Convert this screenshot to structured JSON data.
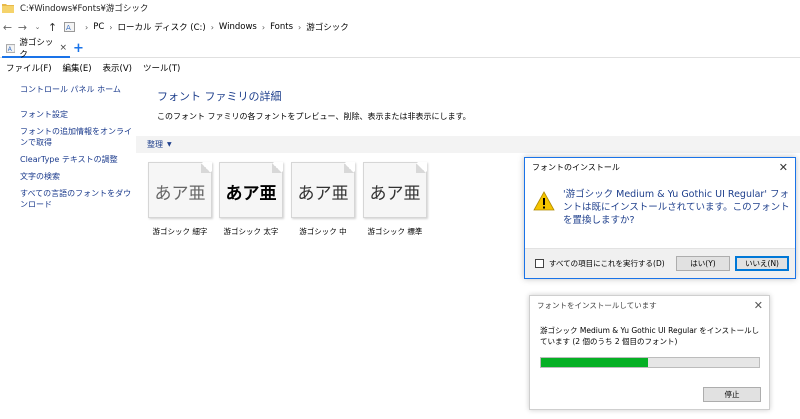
{
  "window": {
    "title": "C:¥Windows¥Fonts¥游ゴシック"
  },
  "address": {
    "crumbs": [
      "PC",
      "ローカル ディスク (C:)",
      "Windows",
      "Fonts",
      "游ゴシック"
    ]
  },
  "tab": {
    "label": "游ゴシック",
    "close": "×",
    "add": "+"
  },
  "menu": {
    "file": "ファイル(F)",
    "edit": "編集(E)",
    "view": "表示(V)",
    "tools": "ツール(T)"
  },
  "sidebar": {
    "home": "コントロール パネル ホーム",
    "items": [
      "フォント設定",
      "フォントの追加情報をオンラインで取得",
      "ClearType テキストの調整",
      "文字の検索",
      "すべての言語のフォントをダウンロード"
    ]
  },
  "main": {
    "heading": "フォント ファミリの詳細",
    "description": "このフォント ファミリの各フォントをプレビュー、削除、表示または非表示にします。",
    "organize": "整理"
  },
  "fonts": [
    {
      "sample": "あア亜",
      "label": "游ゴシック 細字"
    },
    {
      "sample": "あア亜",
      "label": "游ゴシック 太字"
    },
    {
      "sample": "あア亜",
      "label": "游ゴシック 中"
    },
    {
      "sample": "あア亜",
      "label": "游ゴシック 標準"
    }
  ],
  "install_dialog": {
    "title": "フォントのインストール",
    "message": "'游ゴシック Medium & Yu Gothic UI Regular' フォントは既にインストールされています。このフォントを置換しますか?",
    "checkbox_label": "すべての項目にこれを実行する(D)",
    "yes": "はい(Y)",
    "no": "いいえ(N)"
  },
  "progress_dialog": {
    "title": "フォントをインストールしています",
    "message": "游ゴシック Medium & Yu Gothic UI Regular をインストールしています (2 個のうち 2 個目のフォント)",
    "progress": 0.49,
    "stop": "停止"
  },
  "colors": {
    "link": "#1a3a8c",
    "accent": "#1a73e8",
    "progress": "#06b025",
    "warning": "#f5c400"
  }
}
